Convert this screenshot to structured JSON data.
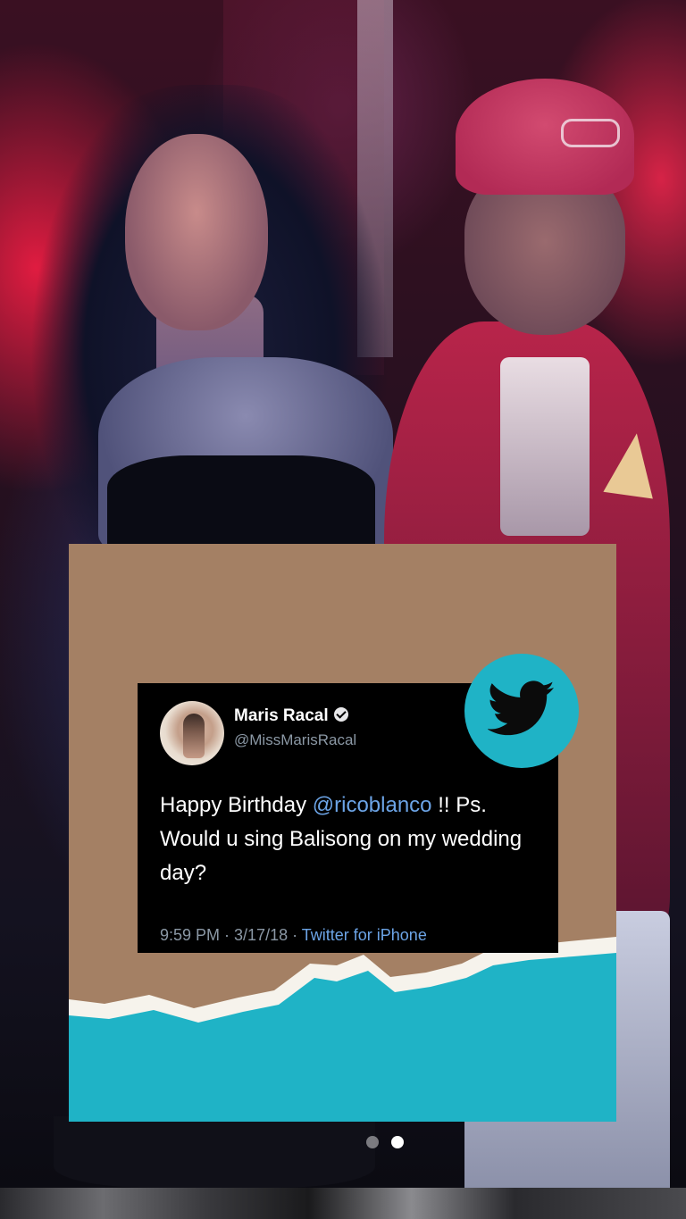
{
  "tweet": {
    "display_name": "Maris Racal",
    "handle": "@MissMarisRacal",
    "text_part1": "Happy Birthday ",
    "mention": "@ricoblanco",
    "text_part2": " !! Ps. Would u sing Balisong on my wedding day?",
    "timestamp": "9:59 PM · 3/17/18 · ",
    "source": "Twitter for iPhone"
  },
  "icons": {
    "verified": "verified-badge-icon",
    "twitter": "twitter-bird-icon"
  },
  "colors": {
    "card_background": "#a48064",
    "accent_teal": "#1fb3c6",
    "link_blue": "#6ca4e6",
    "tweet_background": "#000000"
  },
  "pagination": {
    "total": 2,
    "active": 2
  }
}
